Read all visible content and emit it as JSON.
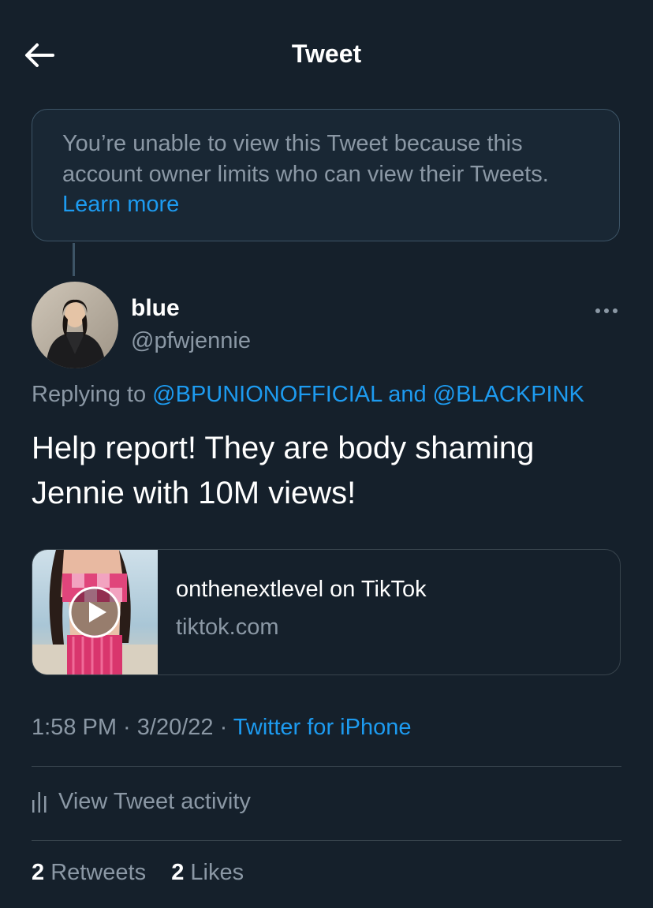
{
  "header": {
    "title": "Tweet",
    "back_icon": "back-arrow-icon"
  },
  "notice": {
    "text": "You’re unable to view this Tweet because this account owner limits who can view their Tweets. ",
    "link": "Learn more"
  },
  "tweet": {
    "display_name": "blue",
    "handle": "@pfwjennie",
    "more_icon": "more-dots-icon",
    "replying_prefix": "Replying to ",
    "mention_1": "@BPUNIONOFFICIAL",
    "mention_joiner": " and ",
    "mention_2": "@BLACKPINK",
    "text": "Help report! They are body shaming Jennie with 10M views!",
    "card": {
      "title": "onthenextlevel on TikTok",
      "domain": "tiktok.com",
      "play_icon": "play-icon"
    },
    "meta": {
      "time": "1:58 PM",
      "sep1": " · ",
      "date": "3/20/22",
      "sep2": " · ",
      "source": "Twitter for iPhone"
    }
  },
  "activity": {
    "icon": "analytics-bars-icon",
    "label": "View Tweet activity"
  },
  "stats": {
    "retweets_count": "2",
    "retweets_label": " Retweets",
    "likes_count": "2",
    "likes_label": " Likes"
  },
  "colors": {
    "background": "#15202b",
    "accent": "#1d9bf0",
    "secondary_text": "#8b98a5",
    "border": "#38444d"
  }
}
